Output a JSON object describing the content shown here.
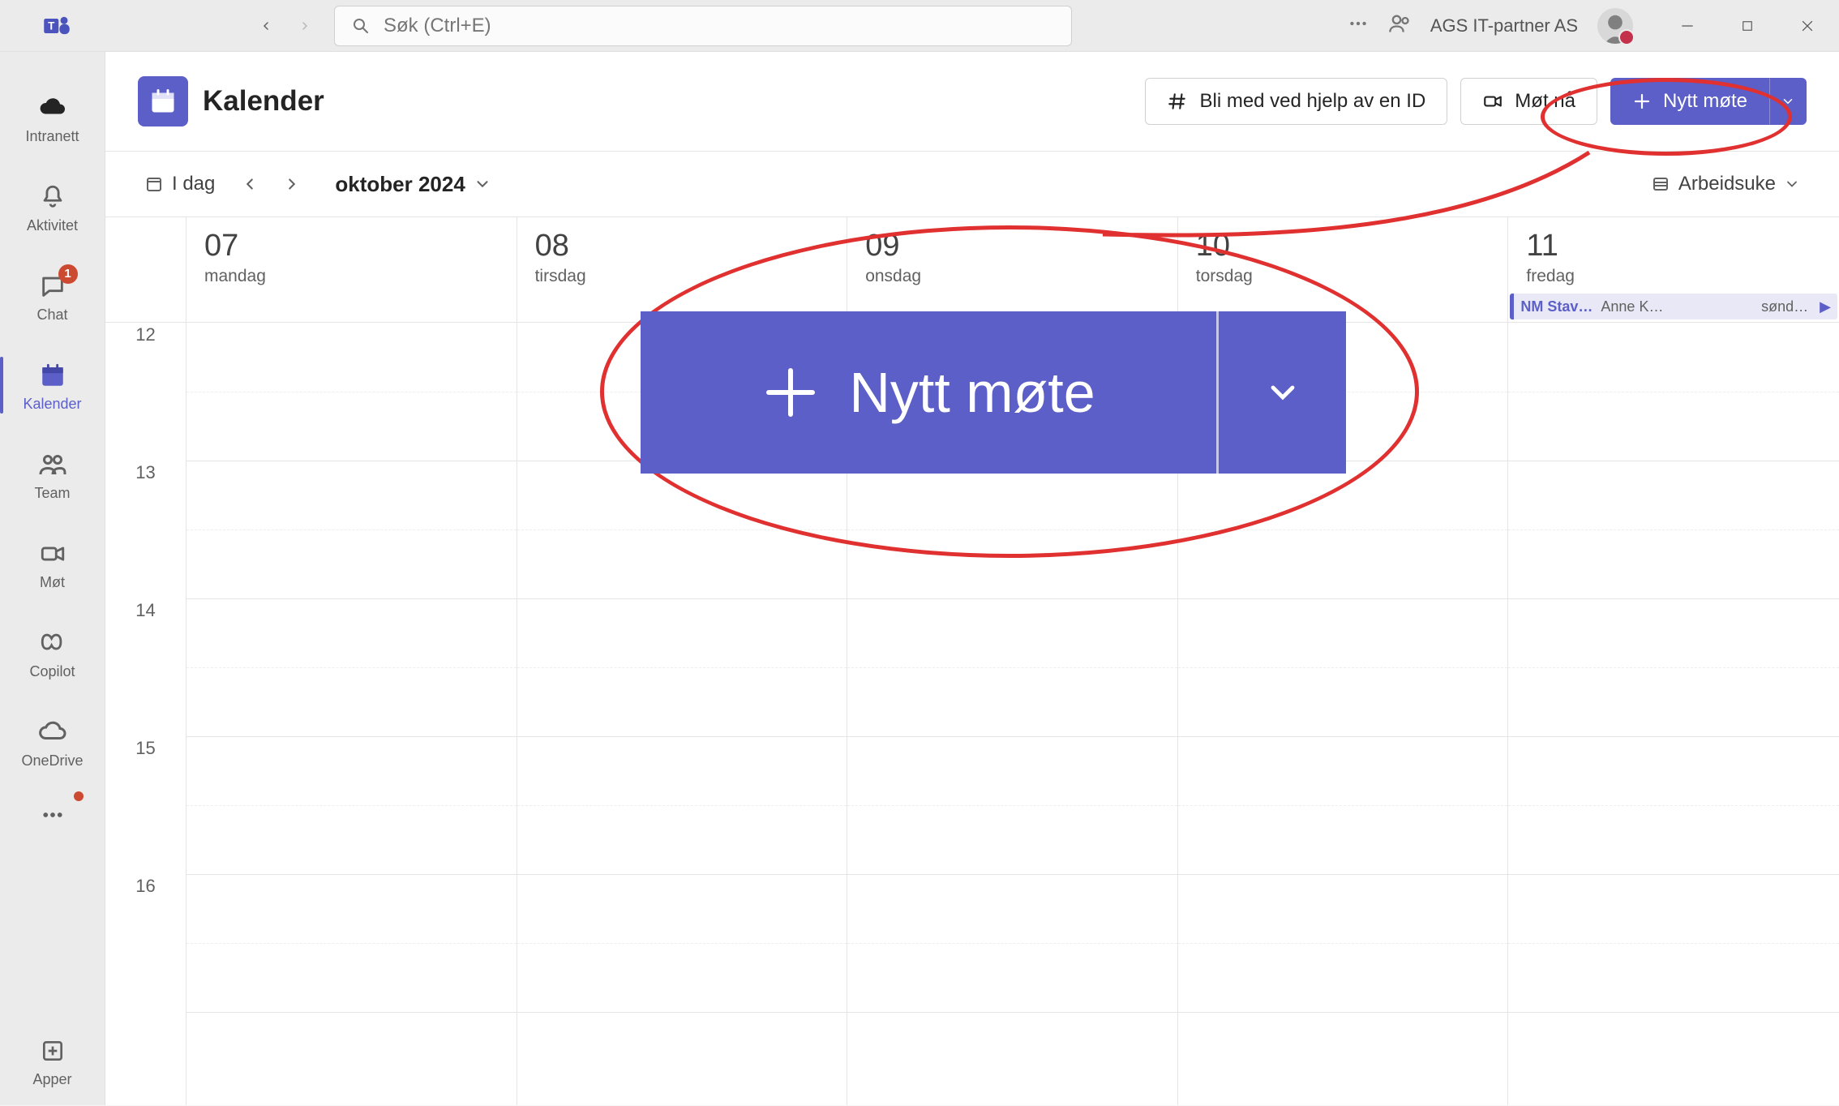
{
  "titlebar": {
    "search_placeholder": "Søk (Ctrl+E)",
    "org_name": "AGS IT-partner AS"
  },
  "sidebar": {
    "items": [
      {
        "label": "Intranett"
      },
      {
        "label": "Aktivitet"
      },
      {
        "label": "Chat",
        "badge": "1"
      },
      {
        "label": "Kalender",
        "selected": true
      },
      {
        "label": "Team"
      },
      {
        "label": "Møt"
      },
      {
        "label": "Copilot"
      },
      {
        "label": "OneDrive"
      }
    ],
    "apps_label": "Apper"
  },
  "calendar": {
    "title": "Kalender",
    "join_by_id": "Bli med ved hjelp av en ID",
    "meet_now": "Møt nå",
    "new_meeting": "Nytt møte",
    "today": "I dag",
    "month_label": "oktober 2024",
    "view_label": "Arbeidsuke",
    "days": [
      {
        "num": "07",
        "name": "mandag"
      },
      {
        "num": "08",
        "name": "tirsdag"
      },
      {
        "num": "09",
        "name": "onsdag"
      },
      {
        "num": "10",
        "name": "torsdag"
      },
      {
        "num": "11",
        "name": "fredag"
      }
    ],
    "times": [
      "12",
      "13",
      "14",
      "15",
      "16"
    ],
    "event": {
      "title": "NM Stav…",
      "organizer": "Anne K…",
      "time": "sønd…"
    }
  },
  "annotation": {
    "big_label": "Nytt møte"
  }
}
